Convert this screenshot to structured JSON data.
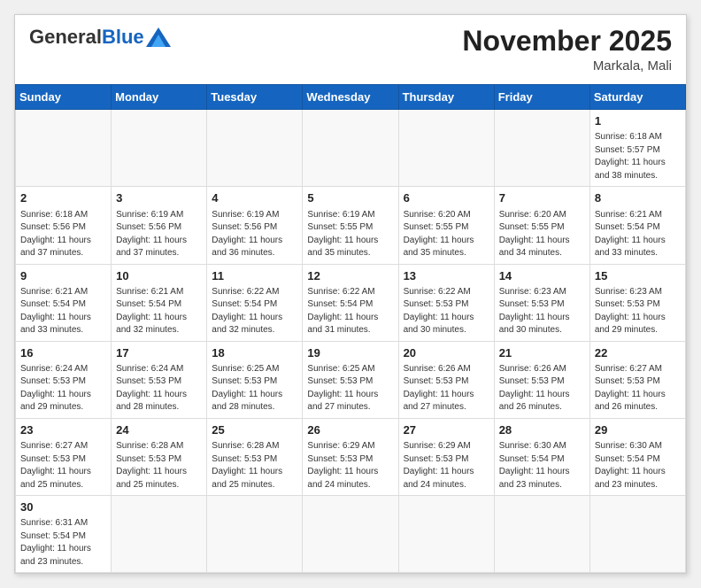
{
  "header": {
    "logo_general": "General",
    "logo_blue": "Blue",
    "month_title": "November 2025",
    "location": "Markala, Mali"
  },
  "weekdays": [
    "Sunday",
    "Monday",
    "Tuesday",
    "Wednesday",
    "Thursday",
    "Friday",
    "Saturday"
  ],
  "weeks": [
    [
      {
        "day": "",
        "info": ""
      },
      {
        "day": "",
        "info": ""
      },
      {
        "day": "",
        "info": ""
      },
      {
        "day": "",
        "info": ""
      },
      {
        "day": "",
        "info": ""
      },
      {
        "day": "",
        "info": ""
      },
      {
        "day": "1",
        "info": "Sunrise: 6:18 AM\nSunset: 5:57 PM\nDaylight: 11 hours\nand 38 minutes."
      }
    ],
    [
      {
        "day": "2",
        "info": "Sunrise: 6:18 AM\nSunset: 5:56 PM\nDaylight: 11 hours\nand 37 minutes."
      },
      {
        "day": "3",
        "info": "Sunrise: 6:19 AM\nSunset: 5:56 PM\nDaylight: 11 hours\nand 37 minutes."
      },
      {
        "day": "4",
        "info": "Sunrise: 6:19 AM\nSunset: 5:56 PM\nDaylight: 11 hours\nand 36 minutes."
      },
      {
        "day": "5",
        "info": "Sunrise: 6:19 AM\nSunset: 5:55 PM\nDaylight: 11 hours\nand 35 minutes."
      },
      {
        "day": "6",
        "info": "Sunrise: 6:20 AM\nSunset: 5:55 PM\nDaylight: 11 hours\nand 35 minutes."
      },
      {
        "day": "7",
        "info": "Sunrise: 6:20 AM\nSunset: 5:55 PM\nDaylight: 11 hours\nand 34 minutes."
      },
      {
        "day": "8",
        "info": "Sunrise: 6:21 AM\nSunset: 5:54 PM\nDaylight: 11 hours\nand 33 minutes."
      }
    ],
    [
      {
        "day": "9",
        "info": "Sunrise: 6:21 AM\nSunset: 5:54 PM\nDaylight: 11 hours\nand 33 minutes."
      },
      {
        "day": "10",
        "info": "Sunrise: 6:21 AM\nSunset: 5:54 PM\nDaylight: 11 hours\nand 32 minutes."
      },
      {
        "day": "11",
        "info": "Sunrise: 6:22 AM\nSunset: 5:54 PM\nDaylight: 11 hours\nand 32 minutes."
      },
      {
        "day": "12",
        "info": "Sunrise: 6:22 AM\nSunset: 5:54 PM\nDaylight: 11 hours\nand 31 minutes."
      },
      {
        "day": "13",
        "info": "Sunrise: 6:22 AM\nSunset: 5:53 PM\nDaylight: 11 hours\nand 30 minutes."
      },
      {
        "day": "14",
        "info": "Sunrise: 6:23 AM\nSunset: 5:53 PM\nDaylight: 11 hours\nand 30 minutes."
      },
      {
        "day": "15",
        "info": "Sunrise: 6:23 AM\nSunset: 5:53 PM\nDaylight: 11 hours\nand 29 minutes."
      }
    ],
    [
      {
        "day": "16",
        "info": "Sunrise: 6:24 AM\nSunset: 5:53 PM\nDaylight: 11 hours\nand 29 minutes."
      },
      {
        "day": "17",
        "info": "Sunrise: 6:24 AM\nSunset: 5:53 PM\nDaylight: 11 hours\nand 28 minutes."
      },
      {
        "day": "18",
        "info": "Sunrise: 6:25 AM\nSunset: 5:53 PM\nDaylight: 11 hours\nand 28 minutes."
      },
      {
        "day": "19",
        "info": "Sunrise: 6:25 AM\nSunset: 5:53 PM\nDaylight: 11 hours\nand 27 minutes."
      },
      {
        "day": "20",
        "info": "Sunrise: 6:26 AM\nSunset: 5:53 PM\nDaylight: 11 hours\nand 27 minutes."
      },
      {
        "day": "21",
        "info": "Sunrise: 6:26 AM\nSunset: 5:53 PM\nDaylight: 11 hours\nand 26 minutes."
      },
      {
        "day": "22",
        "info": "Sunrise: 6:27 AM\nSunset: 5:53 PM\nDaylight: 11 hours\nand 26 minutes."
      }
    ],
    [
      {
        "day": "23",
        "info": "Sunrise: 6:27 AM\nSunset: 5:53 PM\nDaylight: 11 hours\nand 25 minutes."
      },
      {
        "day": "24",
        "info": "Sunrise: 6:28 AM\nSunset: 5:53 PM\nDaylight: 11 hours\nand 25 minutes."
      },
      {
        "day": "25",
        "info": "Sunrise: 6:28 AM\nSunset: 5:53 PM\nDaylight: 11 hours\nand 25 minutes."
      },
      {
        "day": "26",
        "info": "Sunrise: 6:29 AM\nSunset: 5:53 PM\nDaylight: 11 hours\nand 24 minutes."
      },
      {
        "day": "27",
        "info": "Sunrise: 6:29 AM\nSunset: 5:53 PM\nDaylight: 11 hours\nand 24 minutes."
      },
      {
        "day": "28",
        "info": "Sunrise: 6:30 AM\nSunset: 5:54 PM\nDaylight: 11 hours\nand 23 minutes."
      },
      {
        "day": "29",
        "info": "Sunrise: 6:30 AM\nSunset: 5:54 PM\nDaylight: 11 hours\nand 23 minutes."
      }
    ],
    [
      {
        "day": "30",
        "info": "Sunrise: 6:31 AM\nSunset: 5:54 PM\nDaylight: 11 hours\nand 23 minutes."
      },
      {
        "day": "",
        "info": ""
      },
      {
        "day": "",
        "info": ""
      },
      {
        "day": "",
        "info": ""
      },
      {
        "day": "",
        "info": ""
      },
      {
        "day": "",
        "info": ""
      },
      {
        "day": "",
        "info": ""
      }
    ]
  ]
}
